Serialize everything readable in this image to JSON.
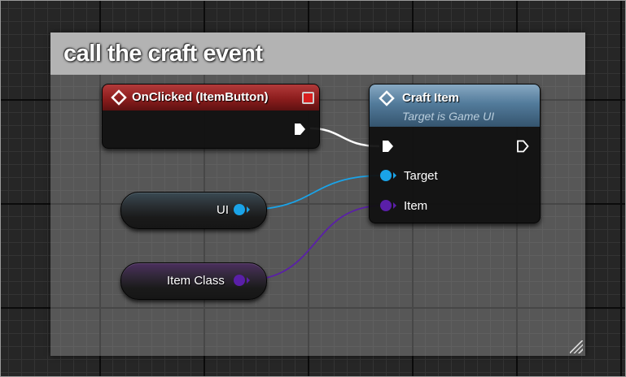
{
  "comment": {
    "title": "call the craft event"
  },
  "nodes": {
    "onclicked": {
      "title": "OnClicked (ItemButton)"
    },
    "craft_item": {
      "title": "Craft Item",
      "subtitle": "Target is Game UI",
      "pins": {
        "target": "Target",
        "item": "Item"
      }
    }
  },
  "variables": {
    "ui": "UI",
    "item_class": "Item Class"
  },
  "colors": {
    "event_header": "#8c1d1d",
    "function_header": "#527b9b",
    "exec_wire": "#ffffff",
    "object_pin": "#1aa3e8",
    "class_pin": "#5a1fa8"
  }
}
